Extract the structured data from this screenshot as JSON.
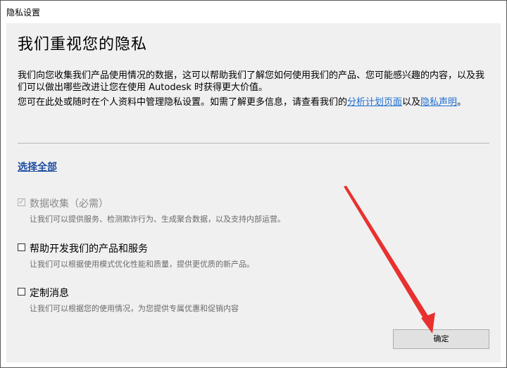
{
  "window": {
    "title": "隐私设置"
  },
  "main": {
    "heading": "我们重视您的隐私",
    "para1": "我们向您收集我们产品使用情况的数据，这可以帮助我们了解您如何使用我们的产品、您可能感兴趣的内容，以及我们可以做出哪些改进让您在使用 Autodesk 时获得更大价值。",
    "para2_prefix": "您可在此处或随时在个人资料中管理隐私设置。如需了解更多信息，请查看我们的",
    "para2_link1": "分析计划页面",
    "para2_mid": "以及",
    "para2_link2": "隐私声明",
    "para2_suffix": "。",
    "select_all": "选择全部"
  },
  "options": [
    {
      "label": "数据收集（必需）",
      "desc": "让我们可以提供服务、检测欺诈行为、生成聚合数据，以及支持内部运营。",
      "checked": true,
      "disabled": true
    },
    {
      "label": "帮助开发我们的产品和服务",
      "desc": "让我们可以根据使用模式优化性能和质量，提供更优质的新产品。",
      "checked": false,
      "disabled": false
    },
    {
      "label": "定制消息",
      "desc": "让我们可以根据您的使用情况，为您提供专属优惠和促销内容",
      "checked": false,
      "disabled": false
    }
  ],
  "footer": {
    "ok_label": "确定"
  },
  "colors": {
    "link": "#1f6fd1",
    "annotation_arrow": "#e8312f"
  }
}
